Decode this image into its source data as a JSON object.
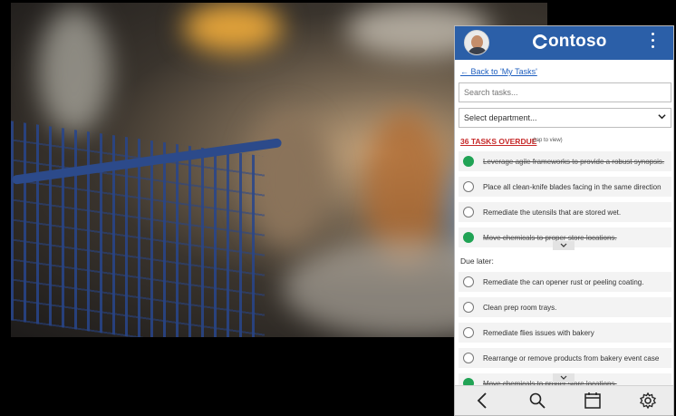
{
  "header": {
    "logo_text": "ontoso",
    "avatar_label": "user-avatar"
  },
  "nav": {
    "back_link": "← Back to 'My Tasks'"
  },
  "search": {
    "placeholder": "Search tasks..."
  },
  "department": {
    "selected": "Select department..."
  },
  "overdue": {
    "label": "36 TASKS OVERDUE",
    "hint": "(tap to view)"
  },
  "tasks": [
    {
      "label": "Leverage agile frameworks to provide a robust synopsis.",
      "done": true
    },
    {
      "label": "Place all clean-knife blades facing in the same direction",
      "done": false
    },
    {
      "label": "Remediate the utensils that are stored wet.",
      "done": false
    },
    {
      "label": "Move chemicals to proper store locations.",
      "done": true
    }
  ],
  "due_later": {
    "label": "Due later:",
    "tasks": [
      {
        "label": "Remediate the can opener rust or peeling coating.",
        "done": false
      },
      {
        "label": "Clean prep room trays.",
        "done": false
      },
      {
        "label": "Remediate flies issues with bakery",
        "done": false
      },
      {
        "label": "Rearrange or remove products from bakery event case",
        "done": false
      },
      {
        "label": "Move chemicals to proper store locations.",
        "done": true
      }
    ]
  },
  "bottom_nav": [
    "back-icon",
    "search-icon",
    "calendar-icon",
    "settings-icon"
  ]
}
